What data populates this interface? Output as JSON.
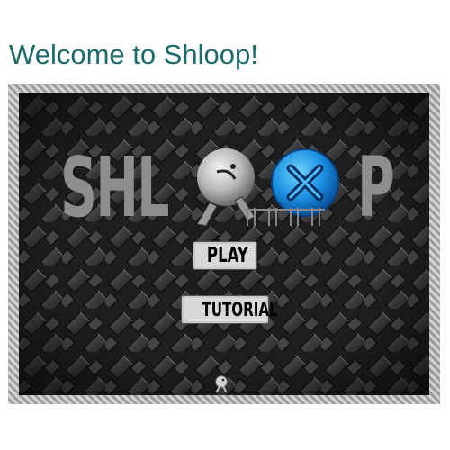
{
  "page": {
    "title": "Welcome to Shloop!"
  },
  "game": {
    "logo": {
      "text_left": "SHL",
      "text_right": "P",
      "color": "#8e8e8e",
      "character_icon": "grey-ball-character-icon",
      "ball_icon": "blue-x-ball-icon"
    },
    "menu": {
      "play_label": "PLAY",
      "tutorial_label": "TUTORIAL"
    },
    "background_pattern": "dark-interlocking-tiles",
    "colors": {
      "title": "#1c6a6a",
      "frame_light": "#d4d4d4",
      "frame_dark": "#9c9c9c",
      "ball_blue": "#1a8fe0",
      "button_bg": "#d8d8d8"
    }
  }
}
